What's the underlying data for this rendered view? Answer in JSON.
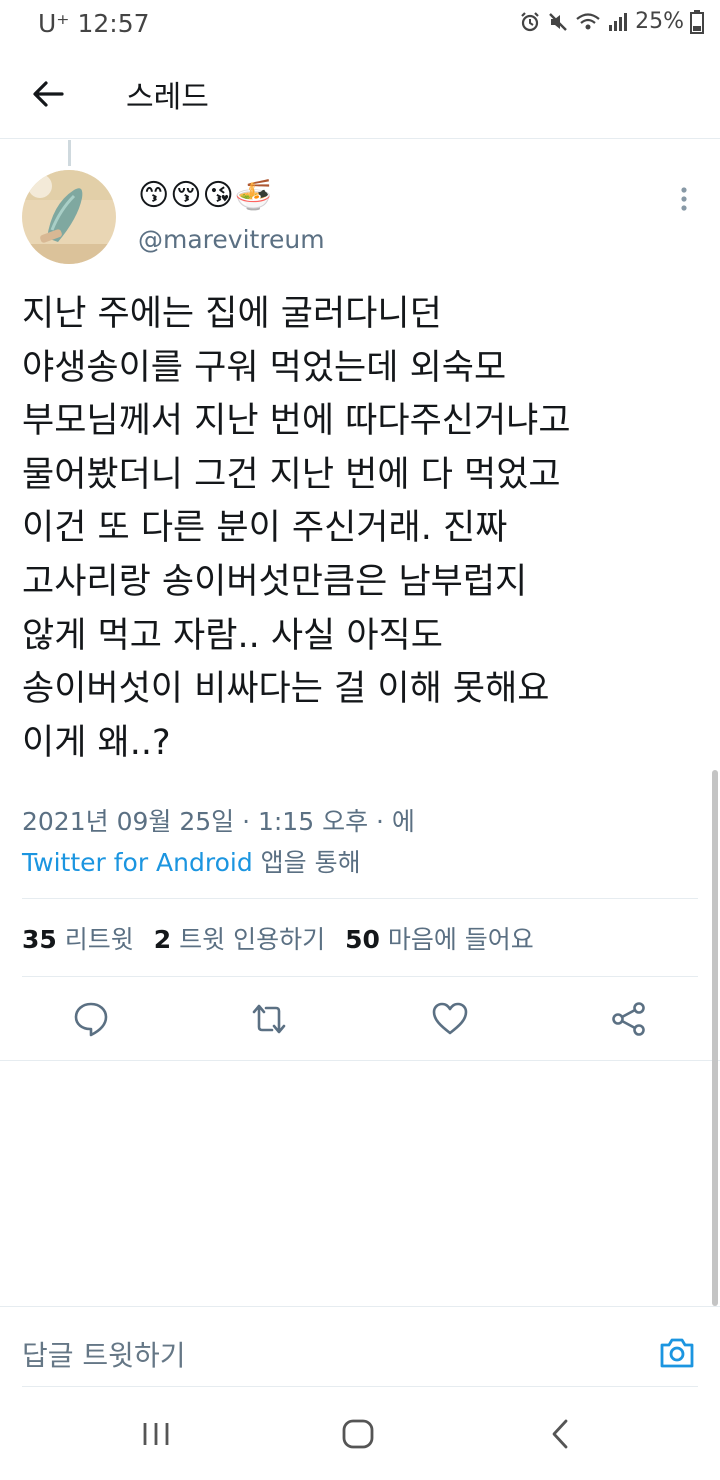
{
  "status_bar": {
    "carrier": "U⁺",
    "time": "12:57",
    "battery": "25%"
  },
  "topbar": {
    "title": "스레드",
    "back_icon": "arrow-left-icon"
  },
  "tweet": {
    "display_name": "😙😚😘🍜",
    "handle": "@marevitreum",
    "text_lines": [
      "지난 주에는 집에 굴러다니던",
      "야생송이를 구워 먹었는데 외숙모",
      "부모님께서 지난 번에 따다주신거냐고",
      "물어봤더니 그건 지난 번에 다 먹었고",
      "이건 또 다른 분이 주신거래. 진짜",
      "고사리랑 송이버섯만큼은 남부럽지",
      "않게 먹고 자람.. 사실 아직도",
      "송이버섯이 비싸다는 걸 이해 못해요",
      "이게 왜..?"
    ],
    "timestamp": "2021년 09월 25일 · 1:15 오후 · 에",
    "via": "Twitter for Android",
    "via_suffix": " 앱을 통해"
  },
  "stats": {
    "retweets_count": "35",
    "retweets_label": "리트윗",
    "quotes_count": "2",
    "quotes_label": "트윗 인용하기",
    "likes_count": "50",
    "likes_label": "마음에 들어요"
  },
  "actions": [
    "reply-icon",
    "retweet-icon",
    "like-icon",
    "share-icon"
  ],
  "reply_box": {
    "placeholder": "답글 트윗하기"
  },
  "colors": {
    "accent": "#1b95e0",
    "text": "#14171a",
    "secondary": "#5b7083",
    "divider": "#e6ecf0"
  }
}
